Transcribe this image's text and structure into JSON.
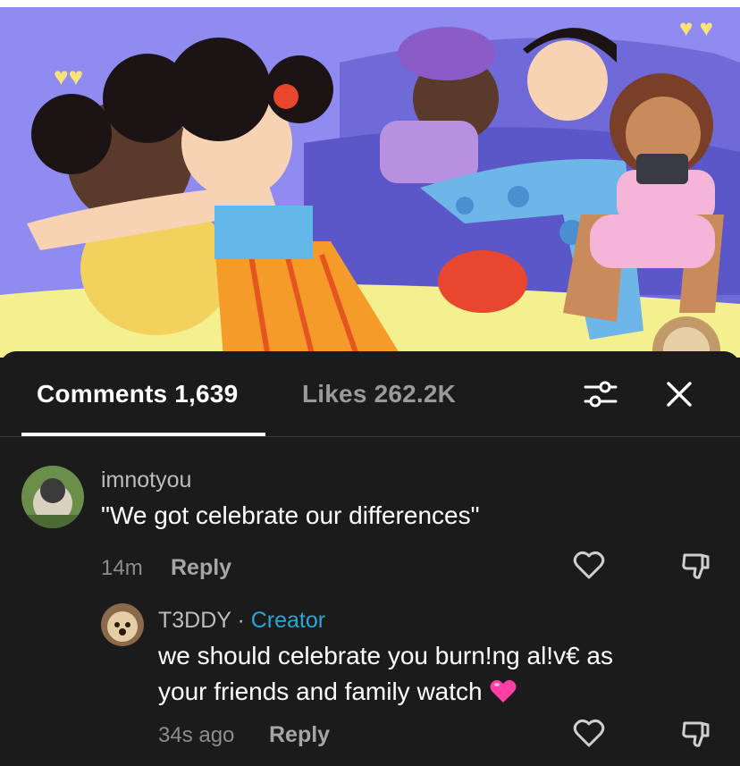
{
  "tabs": {
    "comments_label": "Comments",
    "comments_count": "1,639",
    "likes_label": "Likes",
    "likes_count": "262.2K"
  },
  "icons": {
    "filter": "sliders-icon",
    "close": "close-icon",
    "like": "heart-outline-icon",
    "dislike": "thumbs-down-icon",
    "emoji": "pink-heart-emoji"
  },
  "comments": [
    {
      "username": "imnotyou",
      "text": "\"We got celebrate our differences\"",
      "time": "14m",
      "reply_label": "Reply"
    }
  ],
  "replies": [
    {
      "username": "T3DDY",
      "separator": " · ",
      "badge": "Creator",
      "text_line1": "we should celebrate you burn!ng al!v€ as",
      "text_line2": "your friends and family watch",
      "time": "34s ago",
      "reply_label": "Reply"
    }
  ],
  "colors": {
    "background": "#1b1b1b",
    "creator": "#27a7d6",
    "heart_emoji": "#ff3fa4",
    "art_background": "#8f8bf0"
  }
}
